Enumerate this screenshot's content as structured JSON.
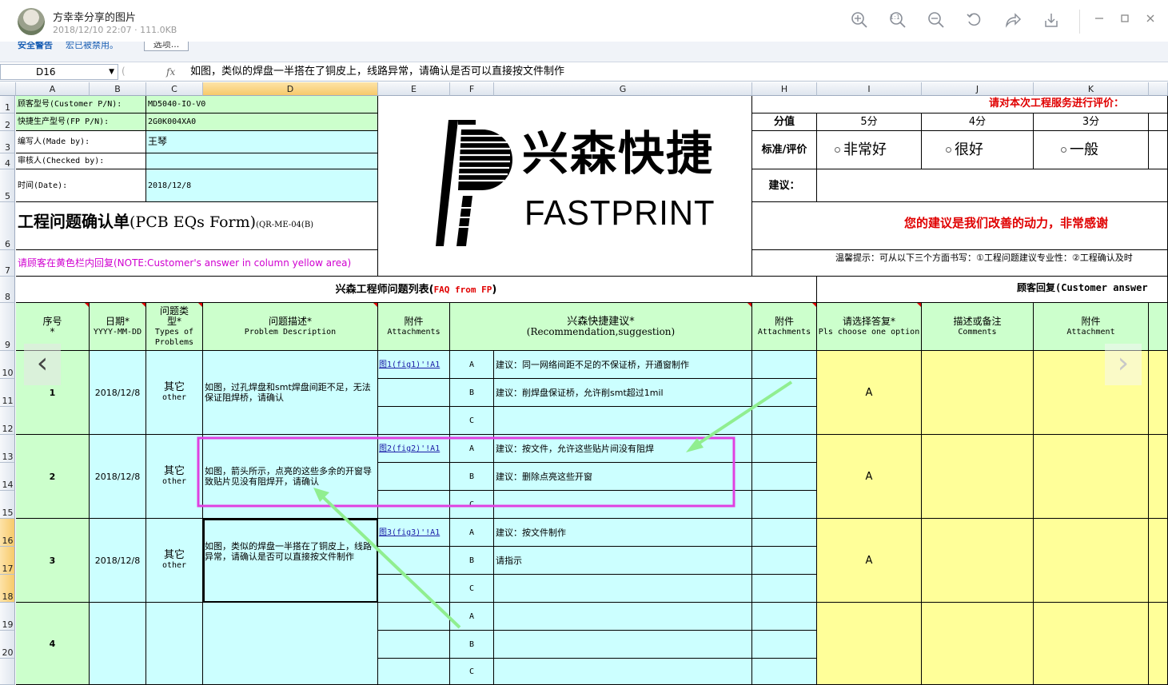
{
  "viewer": {
    "title": "方幸幸分享的图片",
    "meta": "2018/12/10 22:07 · 111.0KB",
    "tools": [
      "zoom-in-icon",
      "actual-size-icon",
      "zoom-out-icon",
      "rotate-icon",
      "share-icon",
      "download-icon"
    ],
    "actual_size_label": "1:1",
    "window_buttons": [
      "minimize",
      "maximize",
      "close"
    ]
  },
  "message_bar": {
    "warning": "安全警告",
    "note": "宏已被禁用。",
    "options": "选项..."
  },
  "formula_bar": {
    "name_box": "D16",
    "fx": "fx",
    "content": "如图，类似的焊盘一半搭在了铜皮上，线路异常，请确认是否可以直接按文件制作"
  },
  "columns": [
    "A",
    "B",
    "C",
    "D",
    "E",
    "F",
    "G",
    "H",
    "I",
    "J",
    "K"
  ],
  "rows": [
    "1",
    "2",
    "3",
    "4",
    "5",
    "6",
    "7",
    "8",
    "9",
    "10",
    "11",
    "12",
    "13",
    "14",
    "15",
    "16",
    "17",
    "18",
    "19",
    "20"
  ],
  "header": {
    "customer_pn_label": "顾客型号(Customer P/N):",
    "customer_pn": "MD5040-IO-V0",
    "fp_pn_label": "快捷生产型号(FP P/N):",
    "fp_pn": "2G0K004XA0",
    "made_by_label": "编写人(Made by):",
    "made_by": "王琴",
    "checked_by_label": "审核人(Checked by):",
    "checked_by": "",
    "date_label": "时间(Date):",
    "date": "2018/12/8",
    "form_title": "工程问题确认单",
    "form_title_en": "(PCB EQs Form)",
    "form_code": "(QR-ME-04(B)",
    "note": "请顾客在黄色栏内回复(NOTE:Customer's answer in column yellow area)"
  },
  "logo": {
    "cn": "兴森快捷",
    "en": "FASTPRINT"
  },
  "rating": {
    "prompt": "请对本次工程服务进行评价：",
    "score_label": "分值",
    "scores": [
      "5分",
      "4分",
      "3分"
    ],
    "standard_label": "标准/评价",
    "levels": [
      "非常好",
      "很好",
      "一般"
    ],
    "suggest_label": "建议：",
    "thanks": "您的建议是我们改善的动力，非常感谢",
    "tip": "温馨提示：可从以下三个方面书写：①工程问题建议专业性：②工程确认及时"
  },
  "sections": {
    "fp_list": "兴森工程师问题列表(",
    "fp_list_en": "FAQ from FP",
    "fp_list_close": ")",
    "customer": "顾客回复(Customer answer"
  },
  "table_headers": {
    "seq": "序号",
    "seq_star": "*",
    "date": "日期*",
    "date_fmt": "YYYY-MM-DD",
    "type": "问题类型*",
    "type_en": "Types of Problems",
    "desc": "问题描述*",
    "desc_en": "Problem Description",
    "attach": "附件",
    "attach_en": "Attachments",
    "rec": "兴森快捷建议*",
    "rec_en": "(Recommendation,suggestion)",
    "attach2": "附件",
    "attach2_en": "Attachments",
    "choose": "请选择答复*",
    "choose_en": "Pls choose one option",
    "comments": "描述或备注",
    "comments_en": "Comments",
    "attach3": "附件",
    "attach3_en": "Attachment"
  },
  "issues": [
    {
      "no": "1",
      "date": "2018/12/8",
      "type": "其它",
      "type_en": "other",
      "desc": "如图，过孔焊盘和smt焊盘间距不足，无法保证阻焊桥，请确认",
      "attach": "图1(fig1)'!A1",
      "options": [
        {
          "k": "A",
          "v": "建议：同一网络间距不足的不保证桥，开通窗制作"
        },
        {
          "k": "B",
          "v": "建议：削焊盘保证桥，允许削smt超过1mil"
        },
        {
          "k": "C",
          "v": ""
        }
      ],
      "answer": "A"
    },
    {
      "no": "2",
      "date": "2018/12/8",
      "type": "其它",
      "type_en": "other",
      "desc": "如图，箭头所示，点亮的这些多余的开窗导致贴片见没有阻焊开，请确认",
      "attach": "图2(fig2)'!A1",
      "options": [
        {
          "k": "A",
          "v": "建议：按文件，允许这些贴片间没有阻焊"
        },
        {
          "k": "B",
          "v": "建议：删除点亮这些开窗"
        },
        {
          "k": "C",
          "v": ""
        }
      ],
      "answer": "A"
    },
    {
      "no": "3",
      "date": "2018/12/8",
      "type": "其它",
      "type_en": "other",
      "desc": "如图，类似的焊盘一半搭在了铜皮上，线路异常，请确认是否可以直接按文件制作",
      "attach": "图3(fig3)'!A1",
      "options": [
        {
          "k": "A",
          "v": "建议：按文件制作"
        },
        {
          "k": "B",
          "v": "请指示"
        },
        {
          "k": "C",
          "v": ""
        }
      ],
      "answer": "A"
    },
    {
      "no": "4",
      "date": "",
      "type": "",
      "type_en": "",
      "desc": "",
      "attach": "",
      "options": [
        {
          "k": "A",
          "v": ""
        },
        {
          "k": "B",
          "v": ""
        },
        {
          "k": "C",
          "v": ""
        }
      ],
      "answer": ""
    }
  ],
  "nav": {
    "prev": "‹",
    "next": "›"
  },
  "colors": {
    "green": "#ccffcc",
    "cyan": "#ccffff",
    "yellow": "#ffff99",
    "highlight": "#e040e0",
    "arrow": "#90ee90",
    "red": "#e00000"
  }
}
